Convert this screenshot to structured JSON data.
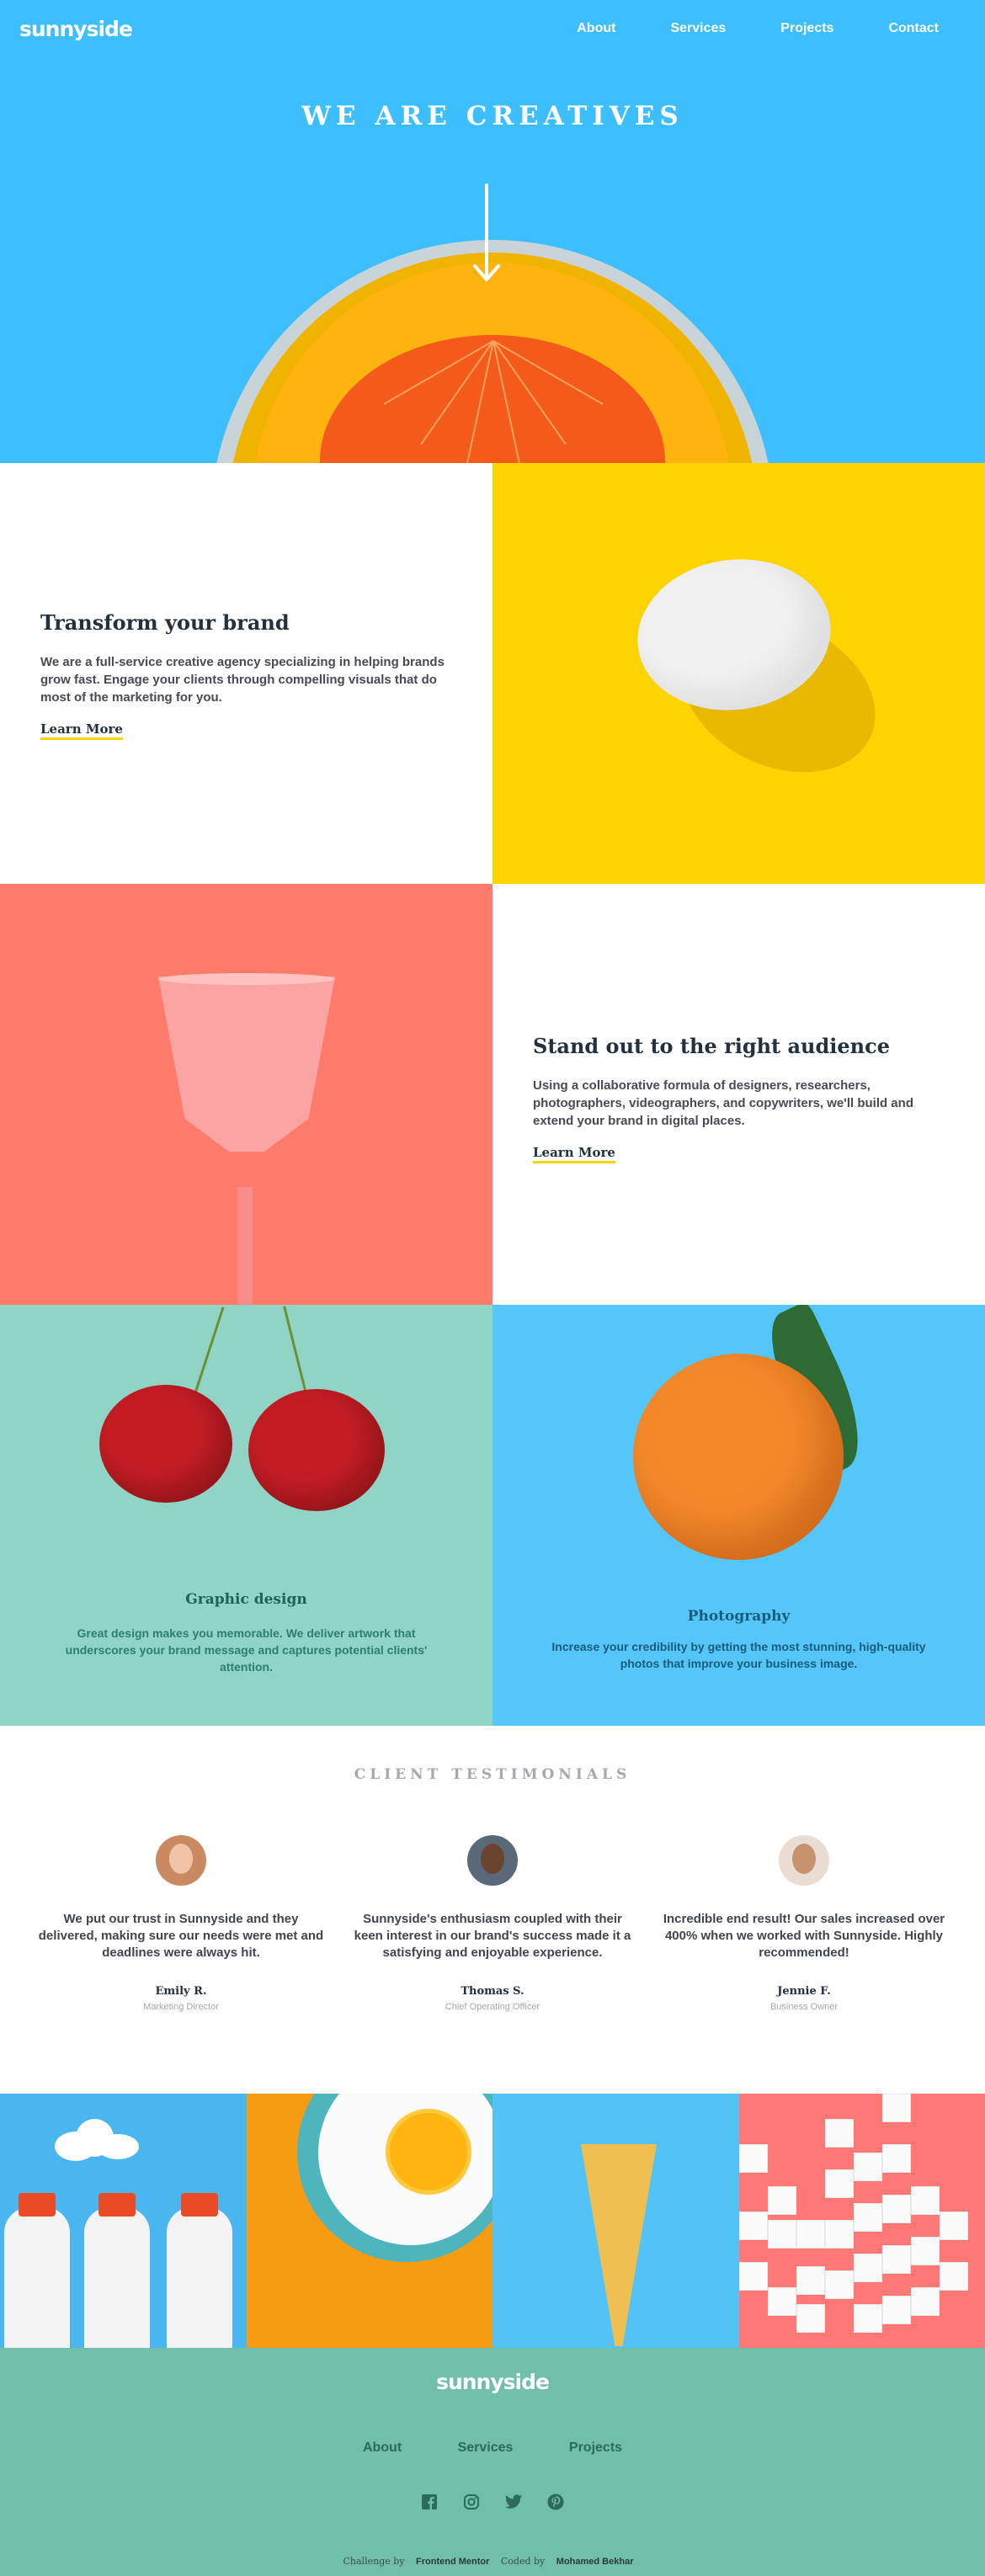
{
  "header": {
    "logo": "sunnyside",
    "nav": [
      "About",
      "Services",
      "Projects",
      "Contact"
    ]
  },
  "hero": {
    "title": "WE ARE CREATIVES",
    "arrow_icon": "arrow-down-icon"
  },
  "features": [
    {
      "title": "Transform your brand",
      "text": "We are a full-service creative agency specializing in helping brands grow fast. Engage your clients through compelling visuals that do most of the marketing for you.",
      "link": "Learn More"
    },
    {
      "title": "Stand out to the right audience",
      "text": "Using a collaborative formula of designers, researchers, photographers, videographers, and copywriters, we'll build and extend your brand in digital places.",
      "link": "Learn More"
    }
  ],
  "services": [
    {
      "title": "Graphic design",
      "text": "Great design makes you memorable. We deliver artwork that underscores your brand message and captures potential clients' attention."
    },
    {
      "title": "Photography",
      "text": "Increase your credibility by getting the most stunning, high-quality photos that improve your business image."
    }
  ],
  "testimonials": {
    "heading": "CLIENT TESTIMONIALS",
    "items": [
      {
        "quote": "We put our trust in Sunnyside and they delivered, making sure our needs were met and deadlines were always hit.",
        "name": "Emily R.",
        "role": "Marketing Director"
      },
      {
        "quote": "Sunnyside's enthusiasm coupled with their keen interest in our brand's success made it a satisfying and enjoyable experience.",
        "name": "Thomas S.",
        "role": "Chief Operating Officer"
      },
      {
        "quote": "Incredible end result! Our sales increased over 400% when we worked with Sunnyside. Highly recommended!",
        "name": "Jennie F.",
        "role": "Business Owner"
      }
    ]
  },
  "footer": {
    "logo": "sunnyside",
    "nav": [
      "About",
      "Services",
      "Projects"
    ],
    "social_icons": [
      "facebook-icon",
      "instagram-icon",
      "twitter-icon",
      "pinterest-icon"
    ],
    "attribution": {
      "challenge_by": "Challenge by",
      "challenge_link": "Frontend Mentor",
      "coded_by": "Coded by",
      "coder": "Mohamed Bekhar"
    }
  },
  "colors": {
    "hero_blue": "#3dbefe",
    "yellow": "#fed400",
    "coral": "#fe7a6b",
    "mint": "#90d4c5",
    "sky": "#55c6f9",
    "footer_green": "#70bfab"
  }
}
